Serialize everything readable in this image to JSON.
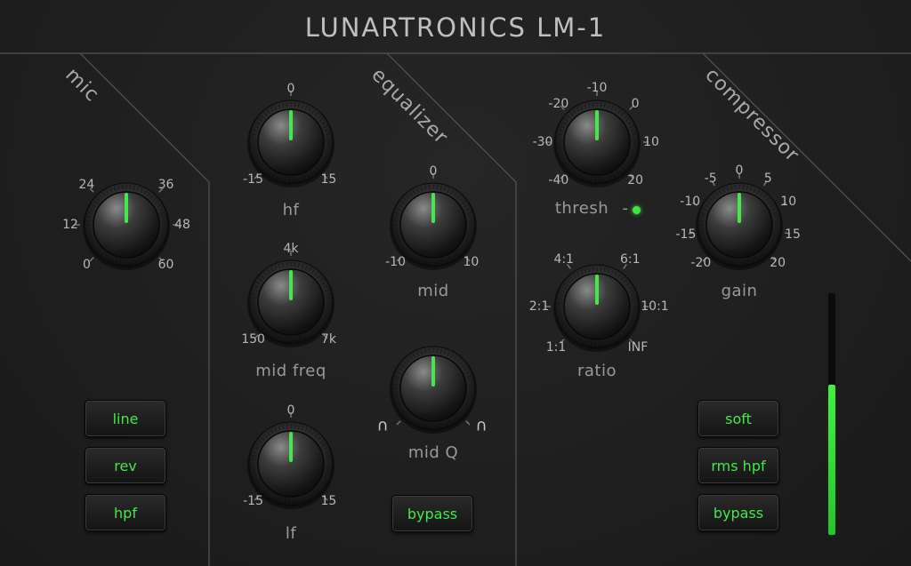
{
  "title": "LUNARTRONICS LM-1",
  "sections": {
    "mic": "mic",
    "equalizer": "equalizer",
    "compressor": "compressor"
  },
  "knobs": [
    {
      "id": "mic-gain",
      "label": "",
      "ticks": [
        "0",
        "12",
        "24",
        "36",
        "48",
        "60"
      ],
      "value": 0.5
    },
    {
      "id": "hf",
      "label": "hf",
      "ticks": [
        "-15",
        "0",
        "15"
      ],
      "value": 0.5
    },
    {
      "id": "mid-freq",
      "label": "mid freq",
      "ticks": [
        "150",
        "4k",
        "7k"
      ],
      "value": 0.5
    },
    {
      "id": "lf",
      "label": "lf",
      "ticks": [
        "-15",
        "0",
        "15"
      ],
      "value": 0.5
    },
    {
      "id": "mid",
      "label": "mid",
      "ticks": [
        "-10",
        "0",
        "10"
      ],
      "value": 0.5
    },
    {
      "id": "mid-q",
      "label": "mid Q",
      "ticks": [
        "∩",
        "∩"
      ],
      "value": 0.5
    },
    {
      "id": "thresh",
      "label": "thresh",
      "ticks": [
        "-40",
        "-30",
        "-20",
        "-10",
        "0",
        "10",
        "20"
      ],
      "value": 0.5
    },
    {
      "id": "ratio",
      "label": "ratio",
      "ticks": [
        "1:1",
        "2:1",
        "4:1",
        "6:1",
        "10:1",
        "INF"
      ],
      "value": 0.5
    },
    {
      "id": "gain",
      "label": "gain",
      "ticks": [
        "-20",
        "-15",
        "-10",
        "-5",
        "0",
        "5",
        "10",
        "15",
        "20"
      ],
      "value": 0.5
    }
  ],
  "thresh_dash": "-",
  "buttons": {
    "line": "line",
    "rev": "rev",
    "hpf": "hpf",
    "eq_bypass": "bypass",
    "soft": "soft",
    "rms_hpf": "rms hpf",
    "comp_bypass": "bypass"
  },
  "meter_level": 0.62,
  "colors": {
    "accent_green": "#43e84a",
    "panel_bg": "#1f1f1f",
    "label_gray": "#9a9a9a"
  }
}
